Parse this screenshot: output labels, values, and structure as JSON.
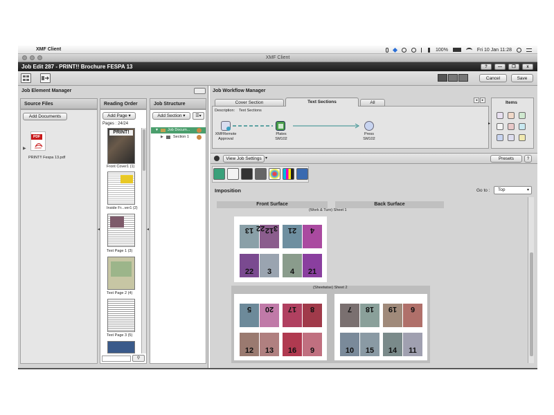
{
  "menubar": {
    "app_name": "XMF Client",
    "date_time": "Fri 10 Jan  11:28",
    "battery": "100%"
  },
  "window": {
    "title": "XMF Client",
    "job_title": "Job Edit 287 - PRINT!! Brochure FESPA 13",
    "help_label": "?",
    "minimize_label": "—",
    "restore_label": "❐",
    "close_label": "x"
  },
  "toolbar": {
    "cancel_label": "Cancel",
    "save_label": "Save"
  },
  "job_element_manager": {
    "title": "Job Element Manager",
    "source_files": {
      "header": "Source Files",
      "add_label": "Add Documents",
      "file_name": "PRINT!! Fespa 13.pdf",
      "pdf_badge": "PDF",
      "pdf_sub": "Adobe"
    },
    "reading_order": {
      "header": "Reading Order",
      "add_label": "Add Page",
      "pages_count": "Pages : 24/24",
      "pages": [
        {
          "label": "Front Cover1 (1)"
        },
        {
          "label": "Inside Fr...ver1 (2)"
        },
        {
          "label": "Text Page 1 (3)"
        },
        {
          "label": "Text Page 2 (4)"
        },
        {
          "label": "Text Page 3 (5)"
        }
      ]
    },
    "job_structure": {
      "header": "Job Structure",
      "add_label": "Add Section",
      "tree": [
        {
          "label": "Job Docum..."
        },
        {
          "label": "Section 1"
        }
      ]
    }
  },
  "job_workflow_manager": {
    "title": "Job Workflow Manager",
    "tabs": [
      {
        "label": "Cover Section"
      },
      {
        "label": "Text Sections"
      },
      {
        "label": "All"
      }
    ],
    "description_label": "Description:",
    "description_value": "Text Sections",
    "nodes": [
      {
        "label": "XMFRemote\nApproval"
      },
      {
        "label": "Plates\nSM102"
      },
      {
        "label": "Press\nSM102"
      }
    ],
    "items_header": "Items"
  },
  "job_settings": {
    "view_label": "View Job Settings",
    "presets_label": "Presets",
    "help_label": "?",
    "section_title": "Imposition",
    "goto_label": "Go to :",
    "goto_value": "Top",
    "front_surface": "Front Surface",
    "back_surface": "Back Surface",
    "sheet1_label": "(Work & Turn) Sheet 1",
    "sheet2_label": "(Sheetwise) Sheet 2"
  },
  "sheet1": {
    "top": [
      "13",
      "12",
      "22",
      "3",
      "21",
      "4"
    ],
    "bottom": [
      "22",
      "3",
      "4",
      "21"
    ]
  },
  "sheet2_front": {
    "top": [
      "5",
      "20",
      "17",
      "8"
    ],
    "bottom": [
      "12",
      "13",
      "16",
      "9"
    ]
  },
  "sheet2_back": {
    "top": [
      "7",
      "18",
      "19",
      "6"
    ],
    "bottom": [
      "10",
      "15",
      "14",
      "11"
    ]
  },
  "colors": {
    "accent_green": "#4a9e6c",
    "workflow_line": "#2e8c8c",
    "magenta_page": "#8a3f8f"
  }
}
